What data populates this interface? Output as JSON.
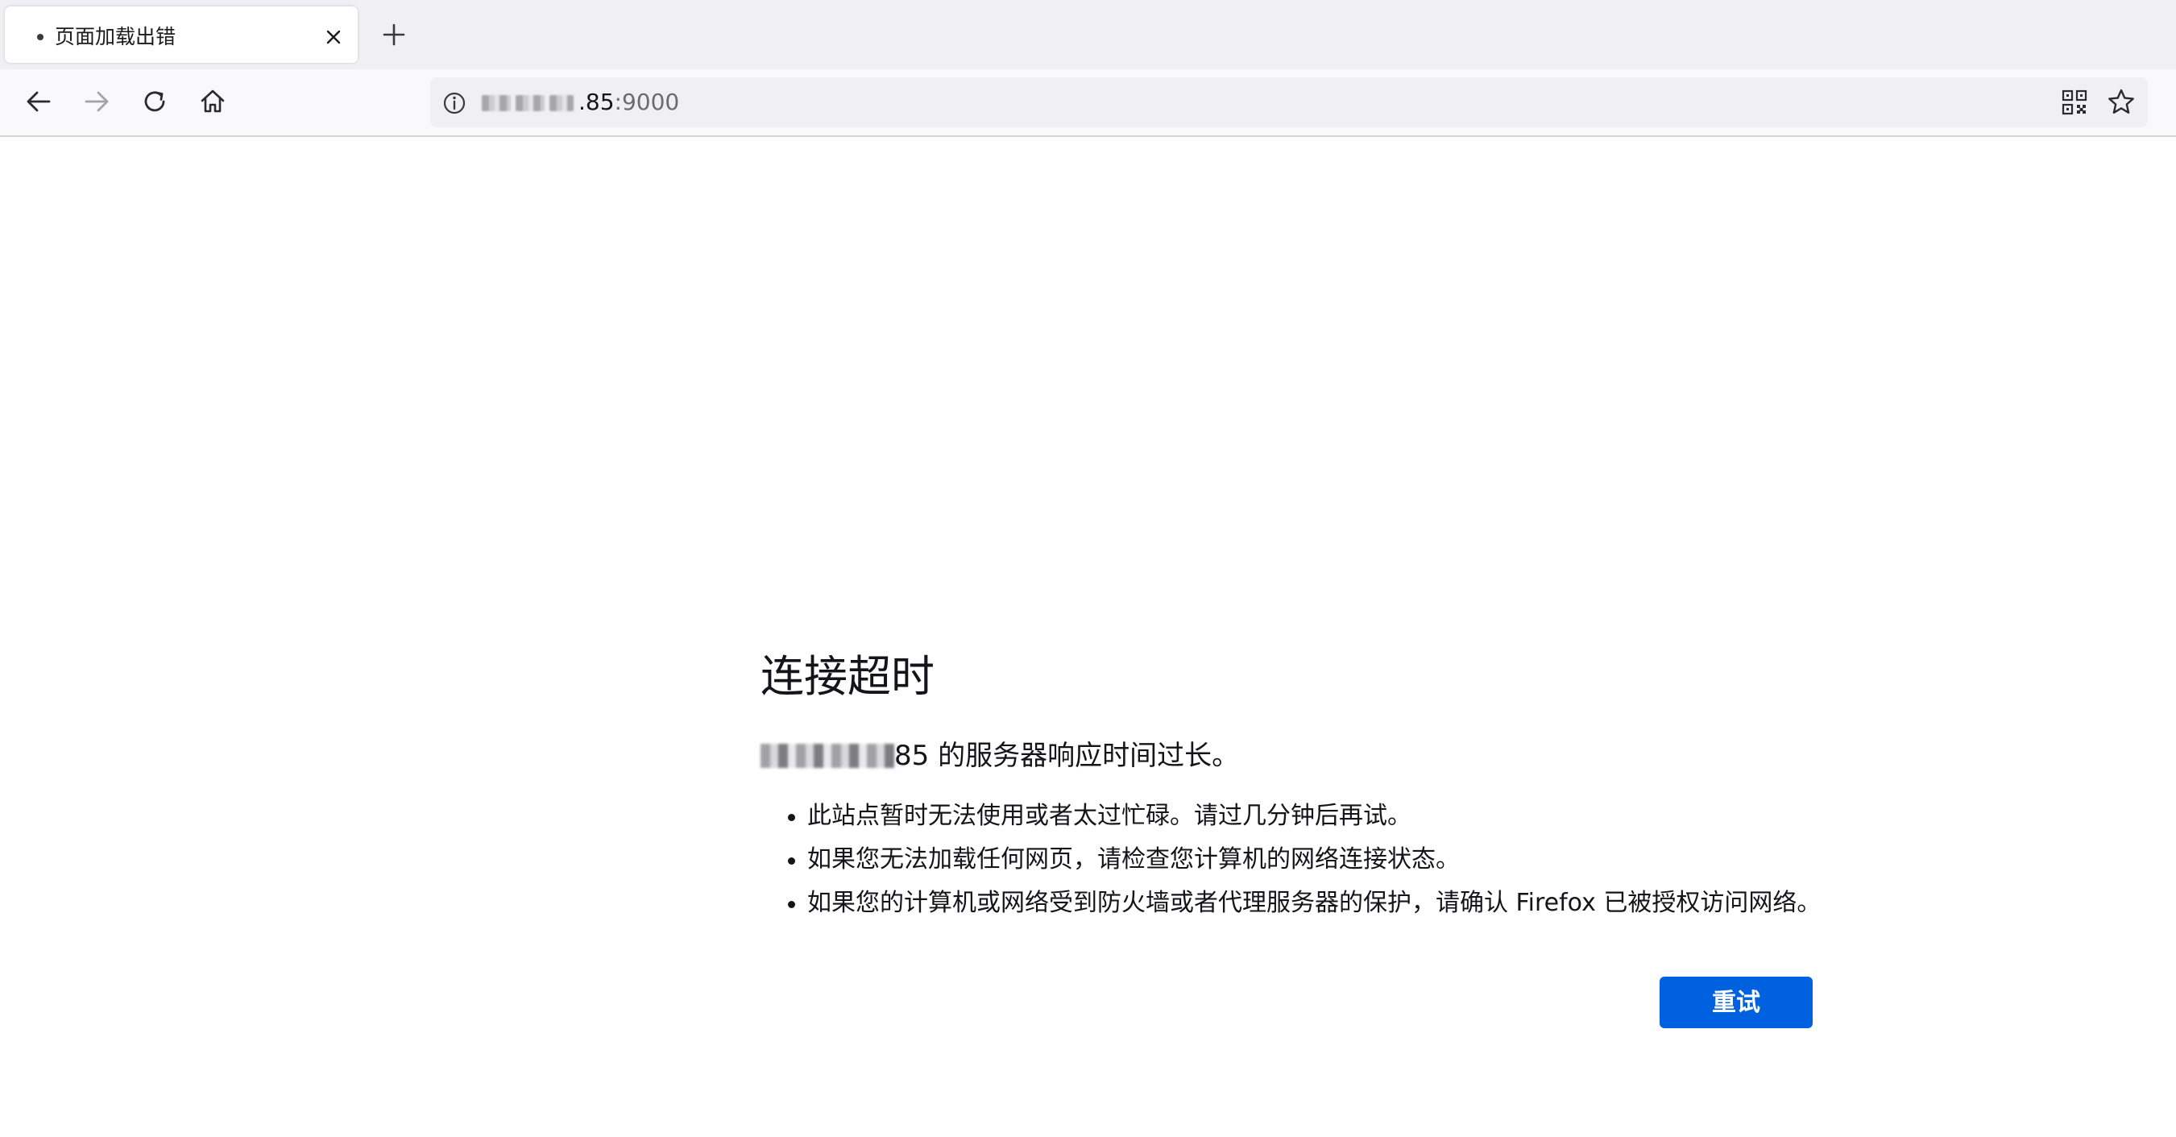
{
  "browser": {
    "tab": {
      "title": "页面加载出错"
    },
    "urlbar": {
      "host_visible": ".85",
      "port": ":9000"
    }
  },
  "error_page": {
    "title": "连接超时",
    "description_suffix": "85 的服务器响应时间过长。",
    "bullets": [
      "此站点暂时无法使用或者太过忙碌。请过几分钟后再试。",
      "如果您无法加载任何网页，请检查您计算机的网络连接状态。",
      "如果您的计算机或网络受到防火墙或者代理服务器的保护，请确认 Firefox 已被授权访问网络。"
    ],
    "retry_label": "重试"
  },
  "colors": {
    "accent": "#0061e0",
    "tabbar_bg": "#f0f0f4",
    "text": "#15141a"
  },
  "icons": [
    "tab-close-icon",
    "new-tab-icon",
    "back-arrow-icon",
    "forward-arrow-icon",
    "reload-icon",
    "home-icon",
    "site-info-icon",
    "qr-code-icon",
    "bookmark-star-icon"
  ]
}
